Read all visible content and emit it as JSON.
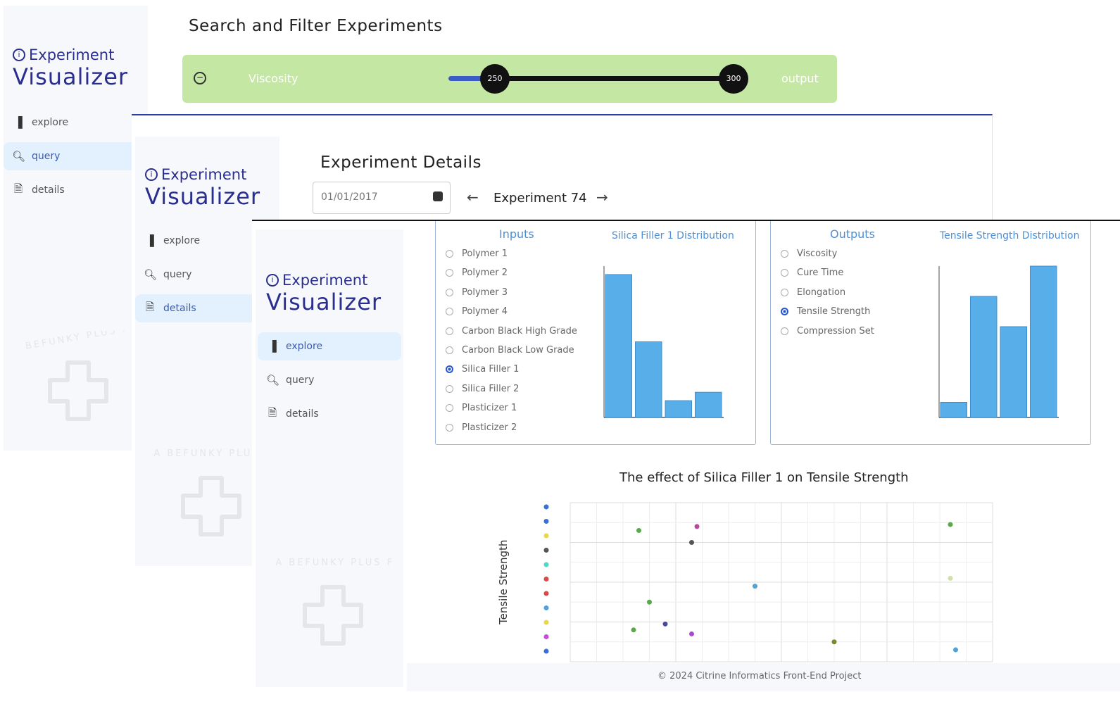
{
  "brand": {
    "line1": "Experiment",
    "line2": "Visualizer"
  },
  "nav": [
    {
      "label": "explore",
      "icon": "chart-icon"
    },
    {
      "label": "query",
      "icon": "search-icon"
    },
    {
      "label": "details",
      "icon": "document-icon"
    }
  ],
  "watermark": {
    "text": "THIS IS A BEFUNKY PLUS FEATURE"
  },
  "search_window": {
    "title": "Search and Filter Experiments",
    "filter": {
      "left_label": "Viscosity",
      "right_label": "output",
      "handle_left": "250",
      "handle_right": "300"
    }
  },
  "details_window": {
    "title": "Experiment Details",
    "date_value": "01/01/2017",
    "experiment_label": "Experiment 74"
  },
  "explore_window": {
    "inputs": {
      "title": "Inputs",
      "options": [
        "Polymer 1",
        "Polymer 2",
        "Polymer 3",
        "Polymer 4",
        "Carbon Black High Grade",
        "Carbon Black Low Grade",
        "Silica Filler 1",
        "Silica Filler 2",
        "Plasticizer 1",
        "Plasticizer 2"
      ],
      "selected": "Silica Filler 1"
    },
    "outputs": {
      "title": "Outputs",
      "options": [
        "Viscosity",
        "Cure Time",
        "Elongation",
        "Tensile Strength",
        "Compression Set"
      ],
      "selected": "Tensile Strength"
    },
    "footer": "© 2024 Citrine Informatics Front-End Project"
  },
  "chart_data": [
    {
      "type": "bar",
      "title": "Silica Filler 1 Distribution",
      "values": [
        17,
        9,
        2,
        3
      ],
      "ylim": [
        0,
        18
      ]
    },
    {
      "type": "bar",
      "title": "Tensile Strength Distribution",
      "values": [
        1,
        8,
        6,
        10
      ],
      "ylim": [
        0,
        10
      ]
    },
    {
      "type": "scatter",
      "title": "The effect of Silica Filler 1 on Tensile Strength",
      "ylabel": "Tensile Strength",
      "points": [
        {
          "x": 0.23,
          "y": 14.6,
          "color": "#5aa84c"
        },
        {
          "x": 0.25,
          "y": 11.0,
          "color": "#5aa84c"
        },
        {
          "x": 0.22,
          "y": 9.6,
          "color": "#5aa84c"
        },
        {
          "x": 0.28,
          "y": 9.9,
          "color": "#4a4a9c"
        },
        {
          "x": 0.33,
          "y": 14.0,
          "color": "#555555"
        },
        {
          "x": 0.34,
          "y": 14.8,
          "color": "#b84a9c"
        },
        {
          "x": 0.33,
          "y": 9.4,
          "color": "#a74ad1"
        },
        {
          "x": 0.45,
          "y": 11.8,
          "color": "#4fa3d8"
        },
        {
          "x": 0.6,
          "y": 9.0,
          "color": "#7a8a2a"
        },
        {
          "x": 0.82,
          "y": 14.9,
          "color": "#5aa84c"
        },
        {
          "x": 0.82,
          "y": 12.2,
          "color": "#cfe0a8"
        },
        {
          "x": 0.83,
          "y": 8.6,
          "color": "#4fa3d8"
        }
      ],
      "legend_colors": [
        "#3b6fd8",
        "#3b6fd8",
        "#e8d84a",
        "#555555",
        "#4fd8c8",
        "#d84a4a",
        "#d84a4a",
        "#4fa3d8",
        "#e8d84a",
        "#c84ad8",
        "#3b6fd8"
      ]
    }
  ]
}
